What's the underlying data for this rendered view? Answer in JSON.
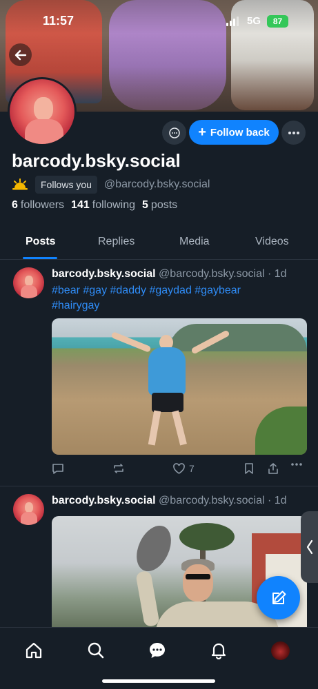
{
  "status_bar": {
    "time": "11:57",
    "network": "5G",
    "battery": "87"
  },
  "profile": {
    "display_name": "barcody.bsky.social",
    "follows_you": "Follows you",
    "handle": "@barcody.bsky.social",
    "followers_count": "6",
    "followers_label": "followers",
    "following_count": "141",
    "following_label": "following",
    "posts_count": "5",
    "posts_label": "posts",
    "follow_back_label": "Follow back"
  },
  "tabs": [
    {
      "label": "Posts",
      "active": true
    },
    {
      "label": "Replies",
      "active": false
    },
    {
      "label": "Media",
      "active": false
    },
    {
      "label": "Videos",
      "active": false
    }
  ],
  "posts": [
    {
      "author": "barcody.bsky.social",
      "handle": "@barcody.bsky.social",
      "time": "· 1d",
      "text_line1": "#bear #gay #daddy #gaydad #gaybear",
      "text_line2": "#hairygay",
      "likes": "7"
    },
    {
      "author": "barcody.bsky.social",
      "handle": "@barcody.bsky.social",
      "time": "· 1d"
    }
  ],
  "colors": {
    "accent": "#1083fe",
    "background": "#161e27",
    "hashtag": "#2f8cf6"
  }
}
